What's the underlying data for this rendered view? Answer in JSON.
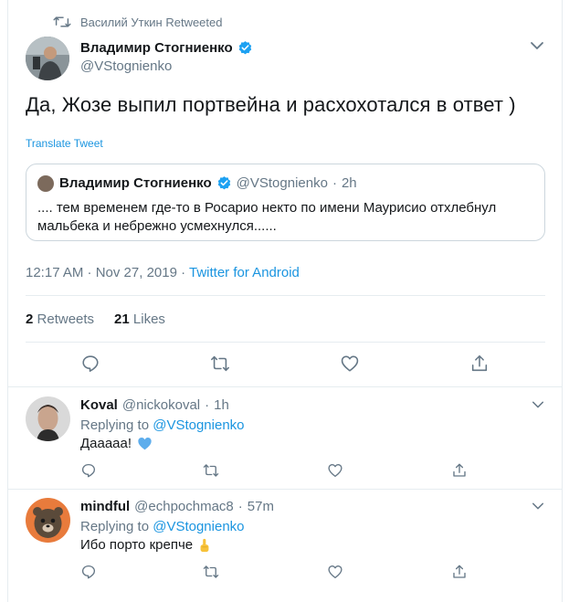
{
  "retweet_context": {
    "label": "Василий Уткин Retweeted"
  },
  "tweet": {
    "author_name": "Владимир Стогниенко",
    "author_handle": "@VStognienko",
    "text": "Да, Жозе выпил портвейна и расхохотался в ответ )",
    "translate_label": "Translate Tweet",
    "quoted": {
      "author_name": "Владимир Стогниенко",
      "author_handle": "@VStognienko",
      "separator": "·",
      "time": "2h",
      "text": ".... тем временем где-то в Росарио  некто по имени Маурисио отхлебнул мальбека и небрежно усмехнулся......"
    },
    "timestamp": "12:17 AM · Nov 27, 2019",
    "timestamp_sep": " · ",
    "source": "Twitter for Android",
    "retweets_count": "2",
    "retweets_label": "Retweets",
    "likes_count": "21",
    "likes_label": "Likes"
  },
  "replies": [
    {
      "author_name": "Koval",
      "author_handle": "@nickokoval",
      "separator": "·",
      "time": "1h",
      "replying_label": "Replying to",
      "replying_to": "@VStognienko",
      "text": "Дааааа!",
      "emoji": "blue-heart-icon"
    },
    {
      "author_name": "mindful",
      "author_handle": "@echpochmac8",
      "separator": "·",
      "time": "57m",
      "replying_label": "Replying to",
      "replying_to": "@VStognienko",
      "text": "Ибо порто крепче",
      "emoji": "pointing-up-icon"
    }
  ],
  "colors": {
    "link": "#1b95e0",
    "muted": "#657786",
    "verified": "#1da1f2",
    "border": "#e6ecf0",
    "heart": "#5dadec"
  }
}
